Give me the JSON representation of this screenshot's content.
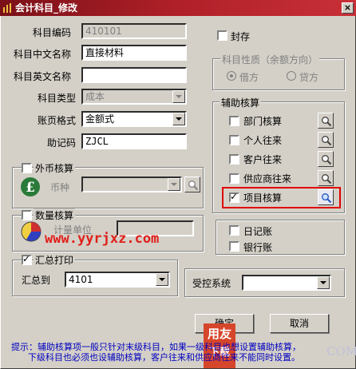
{
  "window": {
    "title": "会计科目_修改"
  },
  "form": {
    "code_label": "科目编码",
    "code_value": "410101",
    "cn_name_label": "科目中文名称",
    "cn_name_value": "直接材料",
    "en_name_label": "科目英文名称",
    "en_name_value": "",
    "type_label": "科目类型",
    "type_value": "成本",
    "page_format_label": "账页格式",
    "page_format_value": "金额式",
    "mnemonic_label": "助记码",
    "mnemonic_value": "ZJCL"
  },
  "seal": {
    "label": "封存",
    "checked": false
  },
  "nature": {
    "title": "科目性质（余额方向）",
    "debit": "借方",
    "credit": "贷方",
    "selected": "借方"
  },
  "aux": {
    "title": "辅助核算",
    "items": [
      {
        "label": "部门核算",
        "checked": false
      },
      {
        "label": "个人往来",
        "checked": false
      },
      {
        "label": "客户往来",
        "checked": false
      },
      {
        "label": "供应商往来",
        "checked": false
      },
      {
        "label": "项目核算",
        "checked": true
      }
    ]
  },
  "foreign": {
    "label": "外币核算",
    "currency_label": "币种",
    "checked": false
  },
  "quantity": {
    "label": "数量核算",
    "unit_label": "计量单位",
    "checked": false
  },
  "journal": {
    "daybook_label": "日记账",
    "bank_label": "银行账"
  },
  "summary": {
    "label": "汇总打印",
    "checked": true,
    "to_label": "汇总到",
    "to_value": "4101"
  },
  "controlled": {
    "label": "受控系统",
    "value": ""
  },
  "buttons": {
    "ok": "确定",
    "cancel": "取消"
  },
  "hint": {
    "line1": "提示：辅助核算项一般只针对末级科目，如果一级科目也想设置辅助核算，",
    "line2": "下级科目也必须也设辅助核算，客户往来和供应商往来不能同时设置。"
  },
  "watermark": {
    "url": "www.yyrjxz.com",
    "logo_top": "用友",
    "logo_bottom": "下载",
    "com": "COM"
  },
  "colors": {
    "title_bar": "#b02028",
    "highlight": "#e00000",
    "hint": "#0000c0",
    "watermark": "#e0201a"
  }
}
